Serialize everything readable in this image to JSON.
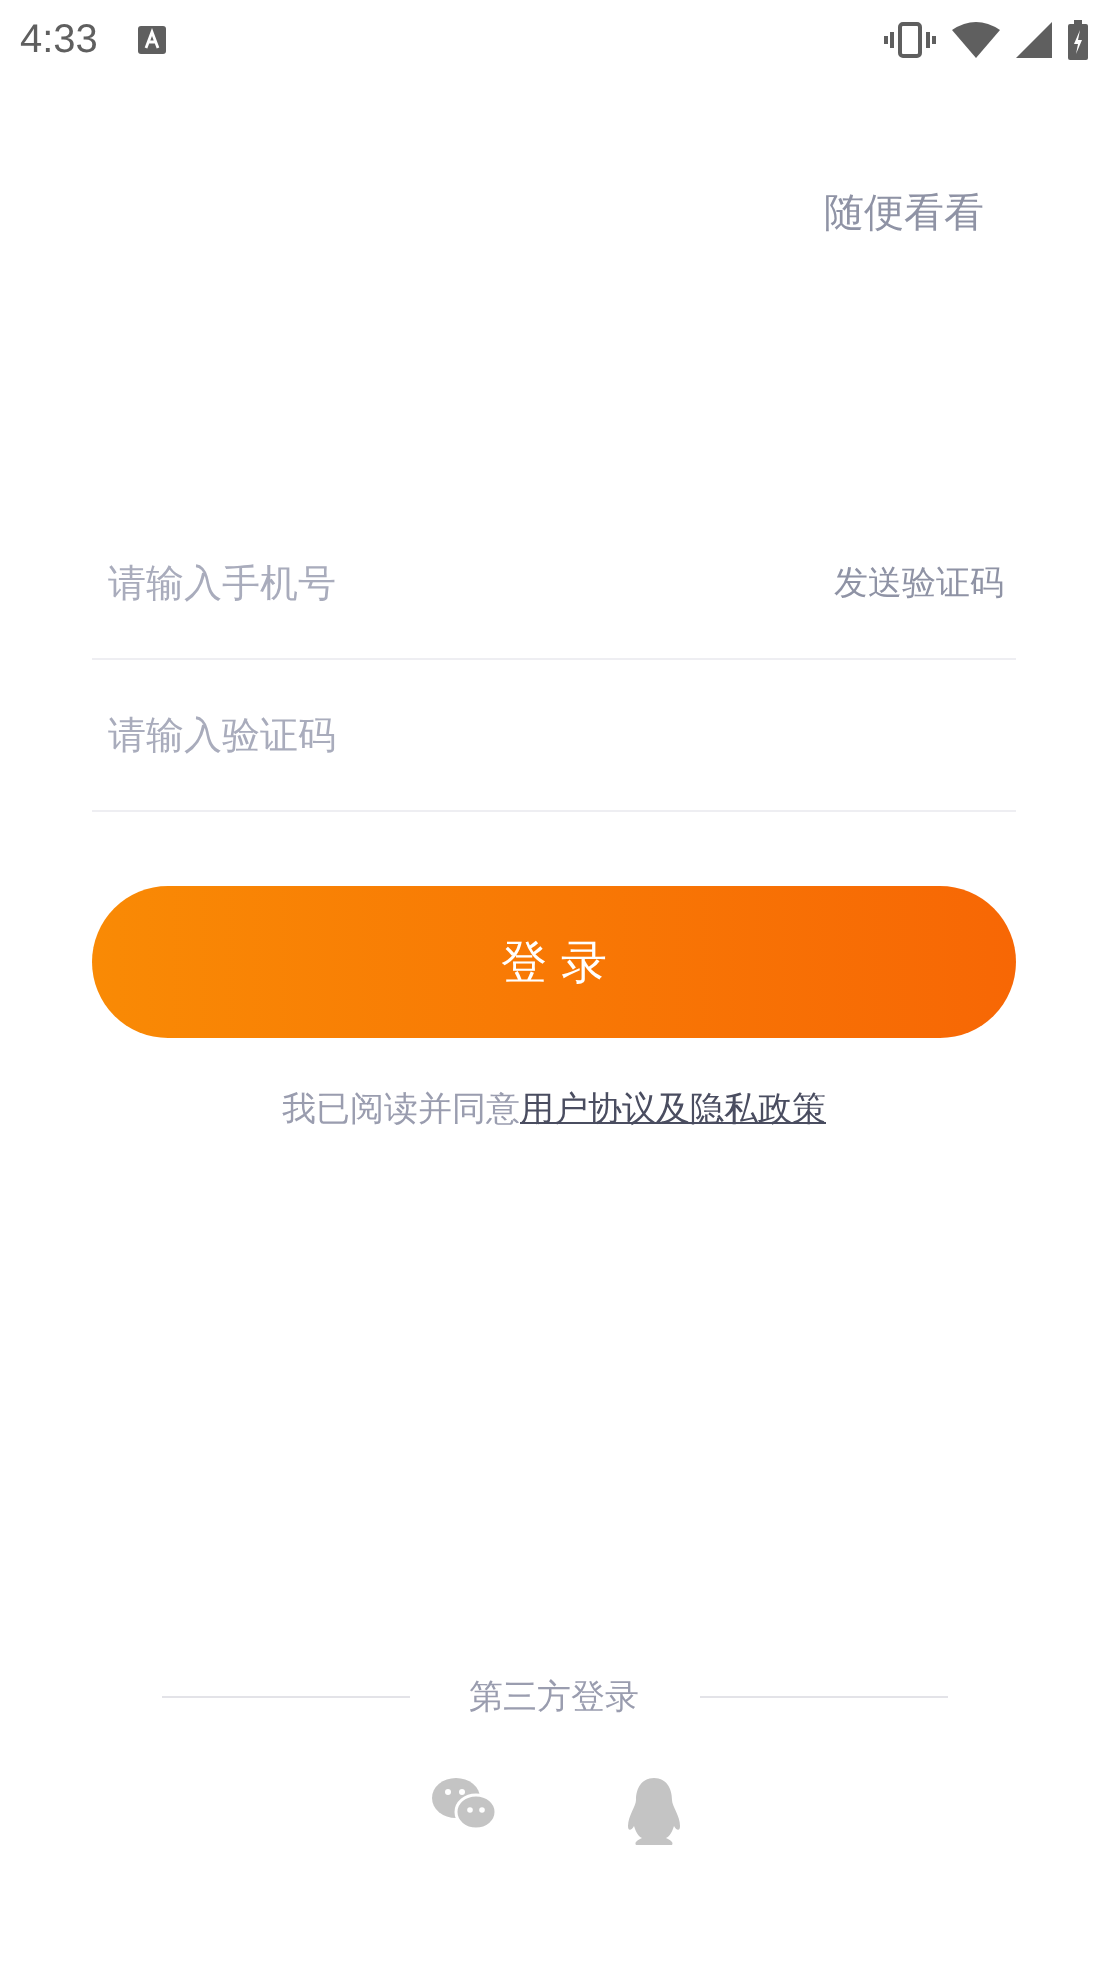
{
  "status_bar": {
    "time": "4:33"
  },
  "browse_link": "随便看看",
  "phone_field": {
    "placeholder": "请输入手机号",
    "action": "发送验证码"
  },
  "code_field": {
    "placeholder": "请输入验证码"
  },
  "login_button": "登 录",
  "agreement": {
    "text": "我已阅读并同意",
    "link": "用户协议及隐私政策"
  },
  "third_party": {
    "title": "第三方登录",
    "options": [
      {
        "kind": "wechat"
      },
      {
        "kind": "qq"
      }
    ]
  }
}
